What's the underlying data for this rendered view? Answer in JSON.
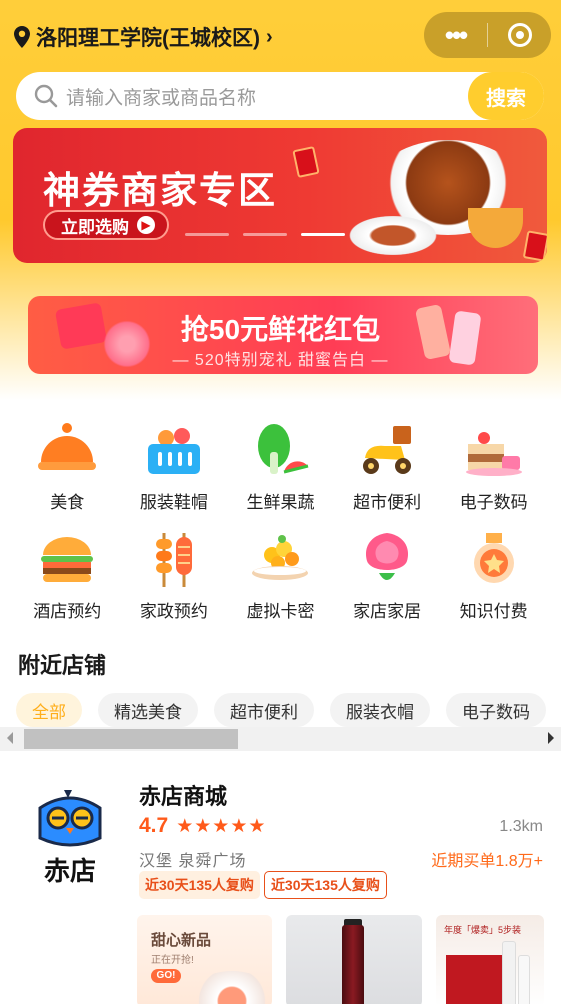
{
  "header": {
    "location": "洛阳理工学院(王城校区)",
    "search_placeholder": "请输入商家或商品名称",
    "search_button": "搜索"
  },
  "banner1": {
    "title": "神券商家专区",
    "cta": "立即选购"
  },
  "banner2": {
    "title": "抢50元鲜花红包",
    "subtitle": "— 520特别宠礼 甜蜜告白 —"
  },
  "categories": [
    {
      "label": "美食",
      "icon": "food-cloche-icon"
    },
    {
      "label": "服装鞋帽",
      "icon": "basket-icon"
    },
    {
      "label": "生鲜果蔬",
      "icon": "vegetable-icon"
    },
    {
      "label": "超市便利",
      "icon": "scooter-icon"
    },
    {
      "label": "电子数码",
      "icon": "cake-icon"
    },
    {
      "label": "酒店预约",
      "icon": "burger-icon"
    },
    {
      "label": "家政预约",
      "icon": "skewer-icon"
    },
    {
      "label": "虚拟卡密",
      "icon": "fruit-plate-icon"
    },
    {
      "label": "家店家居",
      "icon": "rose-icon"
    },
    {
      "label": "知识付费",
      "icon": "medal-icon"
    }
  ],
  "nearby": {
    "title": "附近店铺",
    "filters": [
      "全部",
      "精选美食",
      "超市便利",
      "服装衣帽",
      "电子数码"
    ]
  },
  "shop": {
    "logo_text": "赤店",
    "name": "赤店商城",
    "rating": "4.7",
    "stars": 5,
    "distance": "1.3km",
    "address": "汉堡 泉舜广场",
    "sales": "近期买单1.8万+",
    "tags": [
      "近30天135人复购",
      "近30天135人复购"
    ],
    "products": [
      {
        "title": "甜心新品",
        "subtitle": "正在开抢!",
        "badge": "GO!"
      },
      {
        "title": "SK-II"
      },
      {
        "caption": "年度「爆卖」5步装",
        "brand": "SK-II"
      }
    ]
  },
  "colors": {
    "brand_yellow": "#ffc92d",
    "accent_orange": "#ff5a1a",
    "banner_red": "#e0262e"
  }
}
